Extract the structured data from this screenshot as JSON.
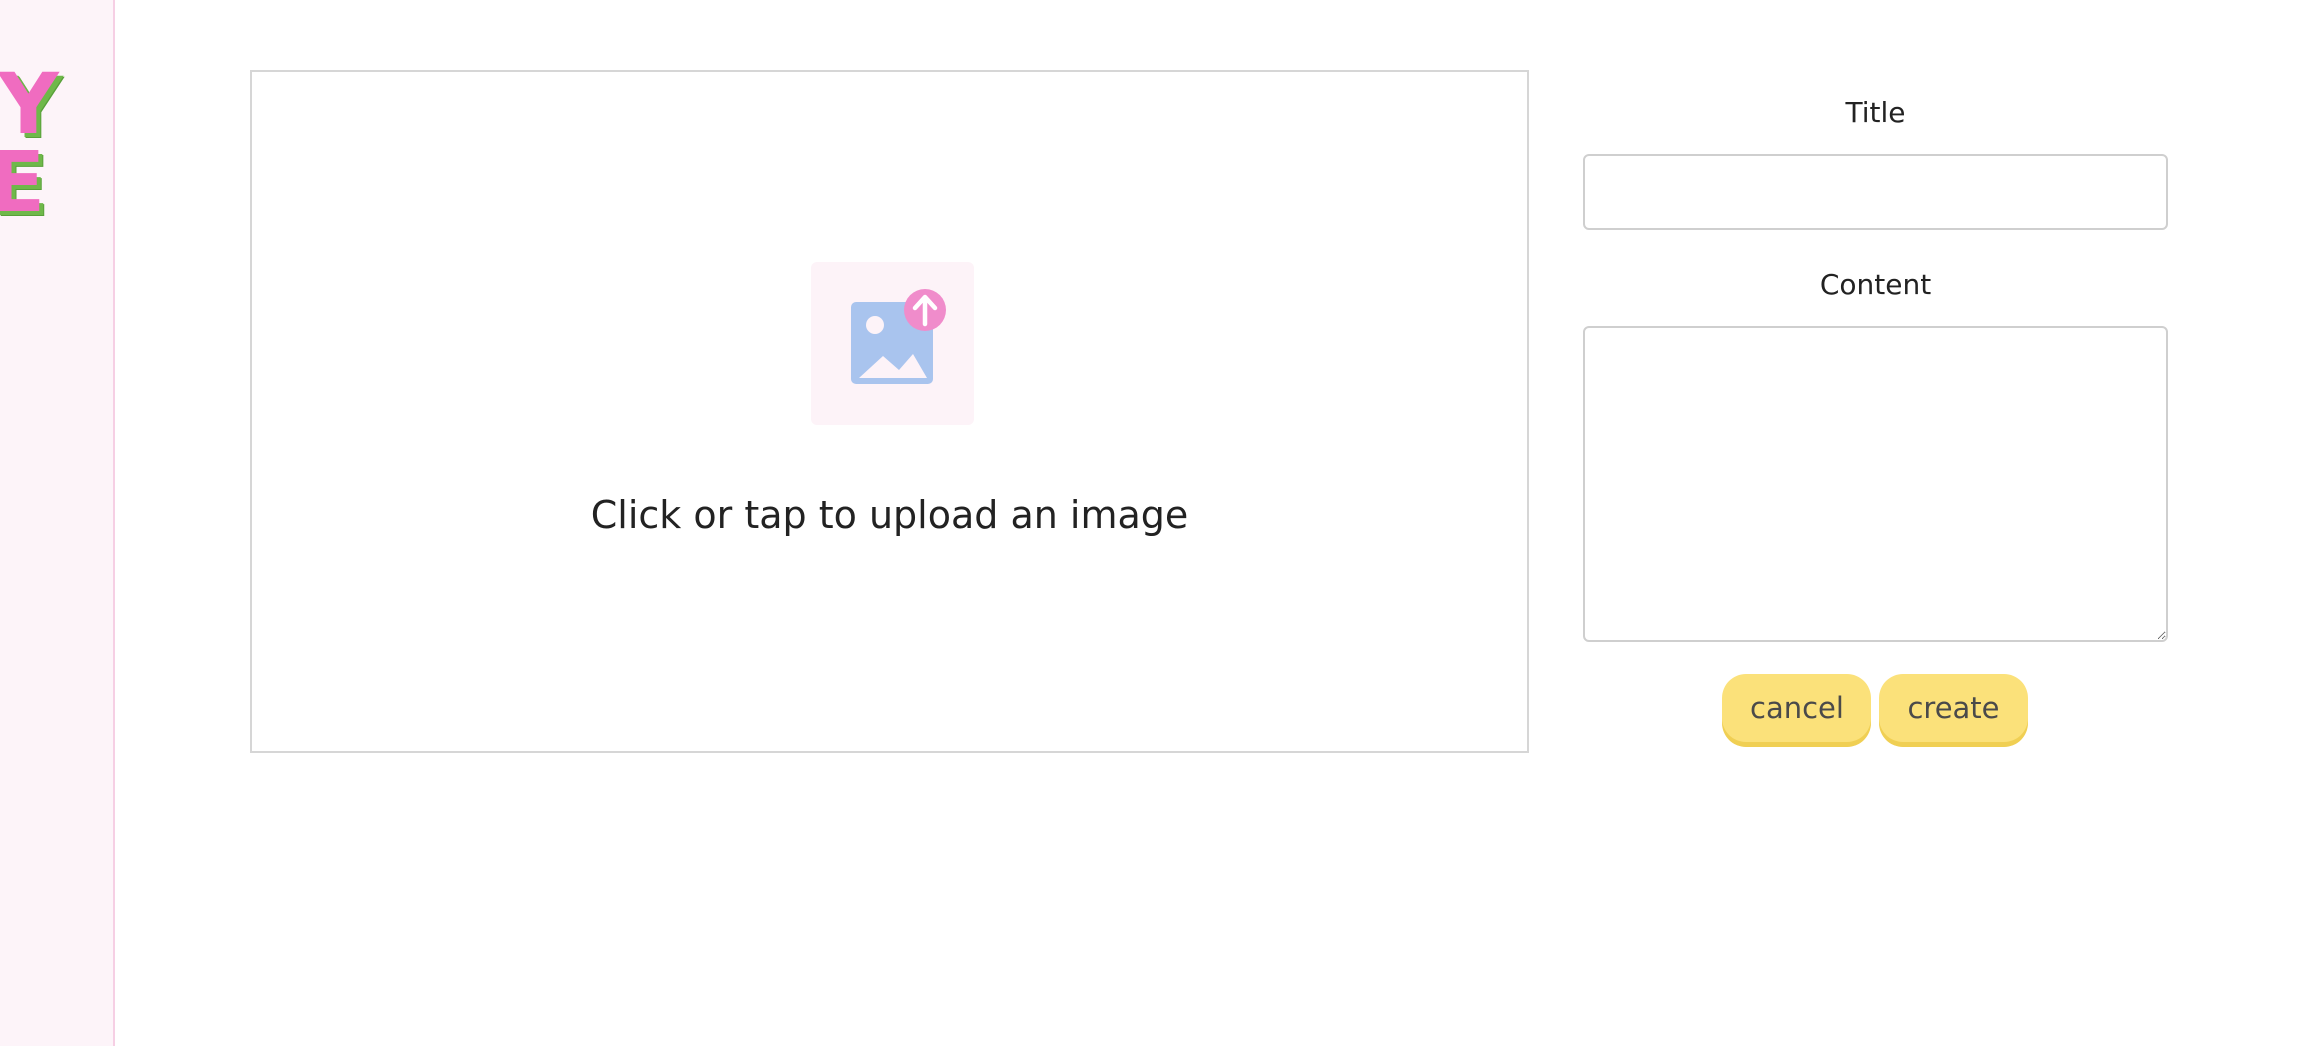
{
  "sidebar": {
    "logo_letters": [
      "Y",
      "E"
    ]
  },
  "upload": {
    "icon": "image-upload-icon",
    "prompt": "Click or tap to upload an image"
  },
  "form": {
    "title_label": "Title",
    "title_value": "",
    "content_label": "Content",
    "content_value": "",
    "cancel_label": "cancel",
    "create_label": "create"
  },
  "colors": {
    "sidebar_bg": "#fdf4f9",
    "logo_pink": "#f06cc0",
    "logo_green": "#6fb84a",
    "button_yellow": "#fbe17a",
    "icon_blue": "#a9c4ee",
    "icon_pink": "#f08ccb"
  }
}
